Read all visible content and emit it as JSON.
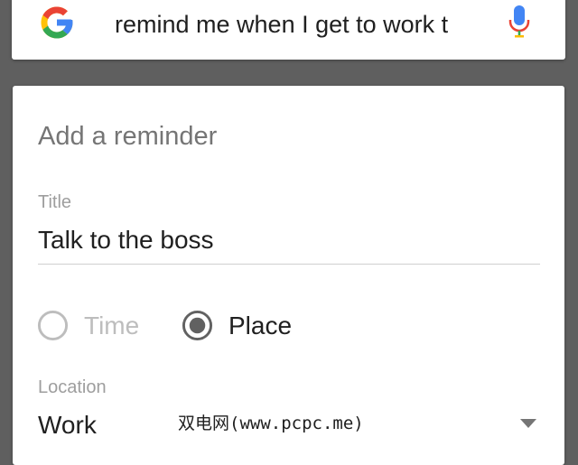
{
  "search": {
    "query": "remind me when I get to work t",
    "logo_icon": "google-g-icon",
    "mic_icon": "microphone-icon"
  },
  "reminder_card": {
    "heading": "Add a reminder",
    "title_field": {
      "label": "Title",
      "value": "Talk to the boss"
    },
    "trigger_options": [
      {
        "label": "Time",
        "selected": false
      },
      {
        "label": "Place",
        "selected": true
      }
    ],
    "location_field": {
      "label": "Location",
      "value": "Work",
      "dropdown_icon": "dropdown-arrow-icon"
    }
  },
  "watermark": "双电网(www.pcpc.me)",
  "colors": {
    "background": "#5f5f5f",
    "card": "#ffffff",
    "google_blue": "#4285f4",
    "google_red": "#ea4335",
    "google_yellow": "#fbbc05",
    "google_green": "#34a853",
    "radio_selected": "#616161",
    "radio_unselected": "#bdbdbd"
  }
}
